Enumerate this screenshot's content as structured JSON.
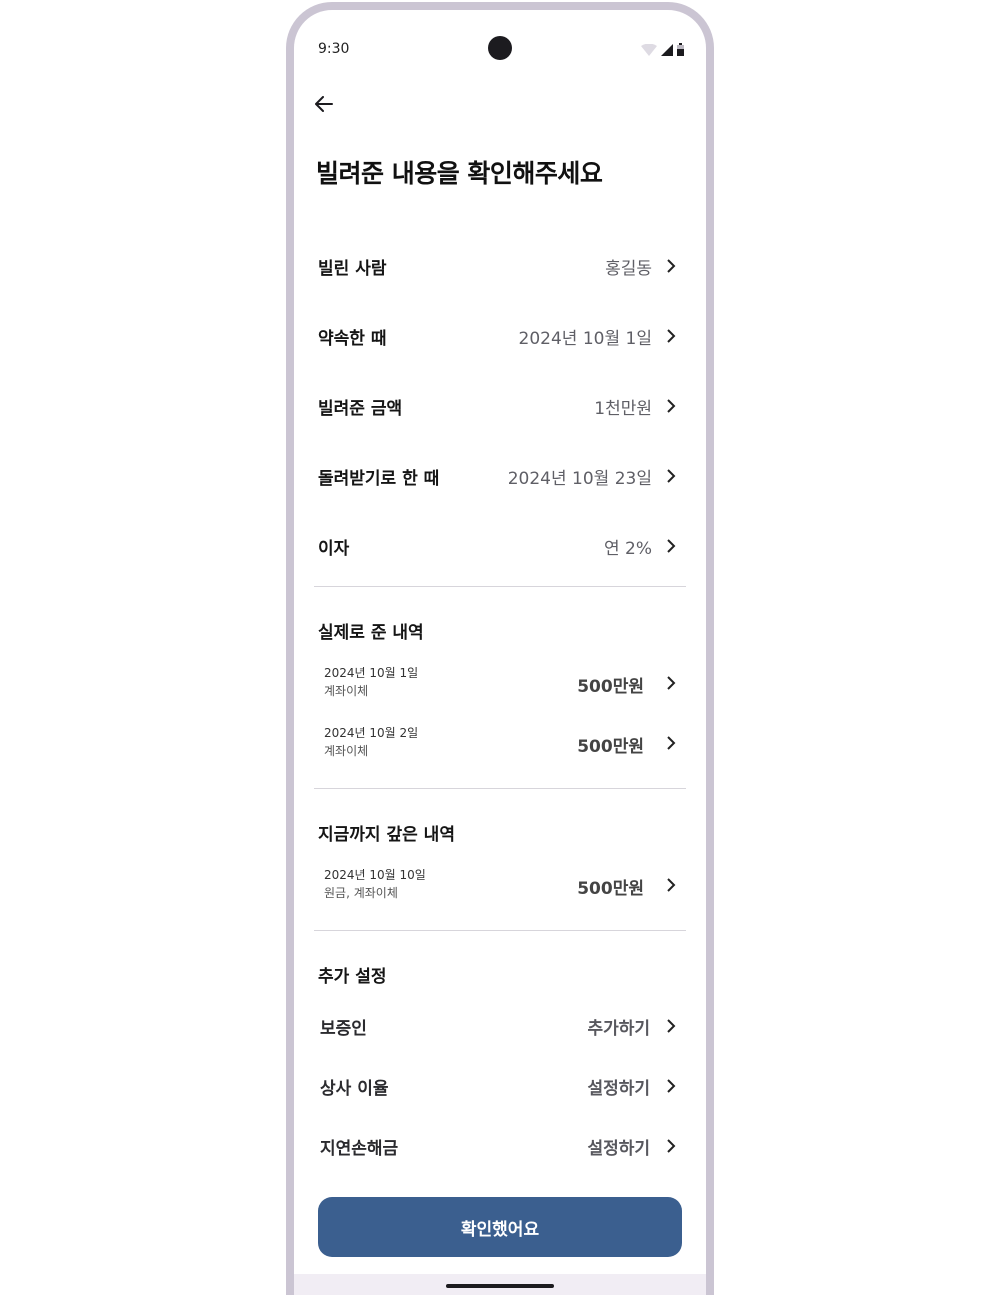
{
  "status_bar": {
    "time": "9:30"
  },
  "header": {
    "title": "빌려준 내용을 확인해주세요"
  },
  "details": [
    {
      "label": "빌린 사람",
      "value": "홍길동"
    },
    {
      "label": "약속한 때",
      "value": "2024년 10월 1일"
    },
    {
      "label": "빌려준 금액",
      "value": "1천만원"
    },
    {
      "label": "돌려받기로 한 때",
      "value": "2024년 10월 23일"
    },
    {
      "label": "이자",
      "value": "연 2%"
    }
  ],
  "given_history": {
    "title": "실제로 준 내역",
    "items": [
      {
        "date": "2024년 10월 1일",
        "method": "계좌이체",
        "amount": "500만원"
      },
      {
        "date": "2024년 10월 2일",
        "method": "계좌이체",
        "amount": "500만원"
      }
    ]
  },
  "repaid_history": {
    "title": "지금까지 갚은 내역",
    "items": [
      {
        "date": "2024년 10월 10일",
        "method": "원금, 계좌이체",
        "amount": "500만원"
      }
    ]
  },
  "extra_settings": {
    "title": "추가 설정",
    "items": [
      {
        "label": "보증인",
        "value": "추가하기"
      },
      {
        "label": "상사 이율",
        "value": "설정하기"
      },
      {
        "label": "지연손해금",
        "value": "설정하기"
      }
    ]
  },
  "confirm_button": {
    "label": "확인했어요"
  },
  "colors": {
    "primary": "#3b5f8f",
    "frame": "#cbc5d3",
    "divider": "#d7d5db"
  },
  "icons": [
    "arrow-back-icon",
    "wifi-icon",
    "signal-icon",
    "battery-icon",
    "chevron-right-icon"
  ]
}
